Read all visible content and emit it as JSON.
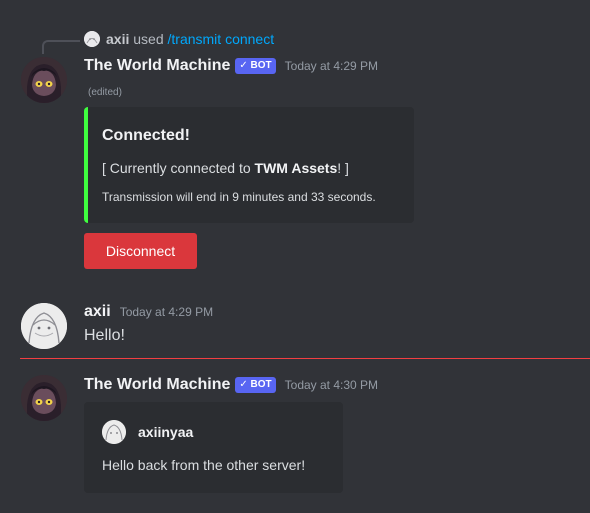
{
  "colors": {
    "background": "#313338",
    "embed_bg": "#2b2d31",
    "embed_accent": "#3ffe3f",
    "danger": "#da373c",
    "bot_tag": "#5865f2",
    "command_link": "#00a8fc",
    "new_messages_divider": "#f23f42"
  },
  "command": {
    "user": "axii",
    "used_text": "used",
    "name": "/transmit connect",
    "avatar_icon": "user-avatar-mini-icon"
  },
  "messages": [
    {
      "author": "The World Machine",
      "bot_tag": "✓ BOT",
      "timestamp": "Today at 4:29 PM",
      "edited": "(edited)",
      "embed": {
        "title": "Connected!",
        "description_prefix": "[ Currently connected to ",
        "description_bold": "TWM Assets",
        "description_suffix": "! ]",
        "footer": "Transmission will end in 9 minutes and 33 seconds."
      },
      "button_label": "Disconnect"
    },
    {
      "author": "axii",
      "timestamp": "Today at 4:29 PM",
      "text": "Hello!"
    },
    {
      "author": "The World Machine",
      "bot_tag": "✓ BOT",
      "timestamp": "Today at 4:30 PM",
      "embed": {
        "author": "axiinyaa",
        "description": "Hello back from the other server!"
      }
    }
  ]
}
